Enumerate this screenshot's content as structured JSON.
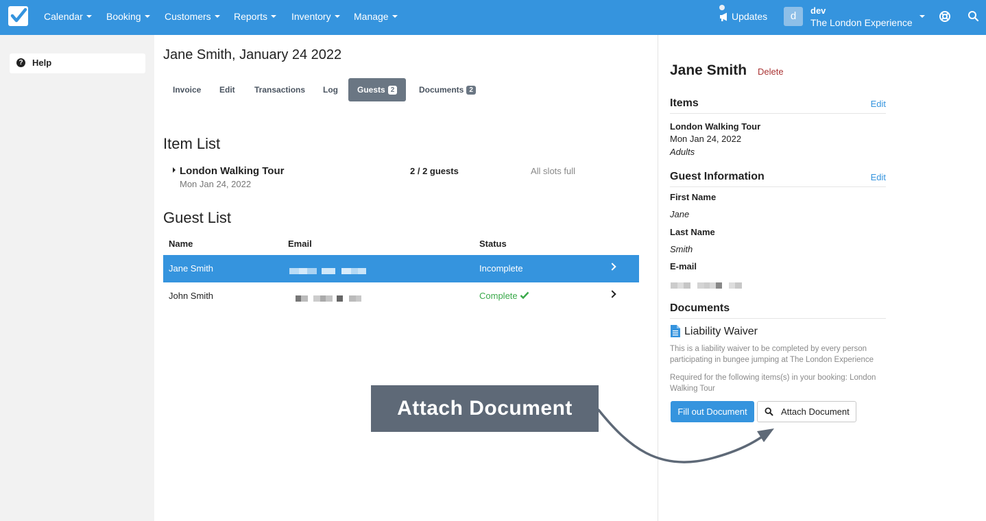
{
  "nav": {
    "items": [
      {
        "label": "Calendar"
      },
      {
        "label": "Booking"
      },
      {
        "label": "Customers"
      },
      {
        "label": "Reports"
      },
      {
        "label": "Inventory"
      },
      {
        "label": "Manage"
      }
    ],
    "updates_label": "Updates",
    "avatar_initial": "d",
    "user_name": "dev",
    "user_org": "The London Experience",
    "brand_color": "#3594de"
  },
  "sidebar": {
    "help_label": "Help"
  },
  "main": {
    "title": "Jane Smith, January 24 2022",
    "tabs": [
      {
        "label": "Invoice"
      },
      {
        "label": "Edit"
      },
      {
        "label": "Transactions"
      },
      {
        "label": "Log"
      },
      {
        "label": "Guests",
        "badge": "2",
        "active": true
      },
      {
        "label": "Documents",
        "badge": "2"
      }
    ],
    "item_list_heading": "Item List",
    "item": {
      "name": "London Walking Tour",
      "date": "Mon Jan 24, 2022",
      "guests": "2 / 2 guests",
      "slots": "All slots full"
    },
    "guest_list_heading": "Guest List",
    "columns": {
      "name": "Name",
      "email": "Email",
      "status": "Status"
    },
    "guests": [
      {
        "name": "Jane Smith",
        "status": "Incomplete",
        "selected": true
      },
      {
        "name": "John Smith",
        "status": "Complete",
        "selected": false
      }
    ]
  },
  "panel": {
    "name": "Jane Smith",
    "delete_label": "Delete",
    "items_heading": "Items",
    "edit_label": "Edit",
    "item_name": "London Walking Tour",
    "item_date": "Mon Jan 24, 2022",
    "item_type": "Adults",
    "guest_info_heading": "Guest Information",
    "first_name_label": "First Name",
    "first_name": "Jane",
    "last_name_label": "Last Name",
    "last_name": "Smith",
    "email_label": "E-mail",
    "documents_heading": "Documents",
    "doc_title": "Liability Waiver",
    "doc_desc": "This is a liability waiver to be completed by every person participating in bungee jumping at The London Experience",
    "doc_required": "Required for the following items(s) in your booking: London Walking Tour",
    "fill_button": "Fill out Document",
    "attach_button": "Attach Document"
  },
  "callout": {
    "label": "Attach Document",
    "color": "#5e6977"
  }
}
